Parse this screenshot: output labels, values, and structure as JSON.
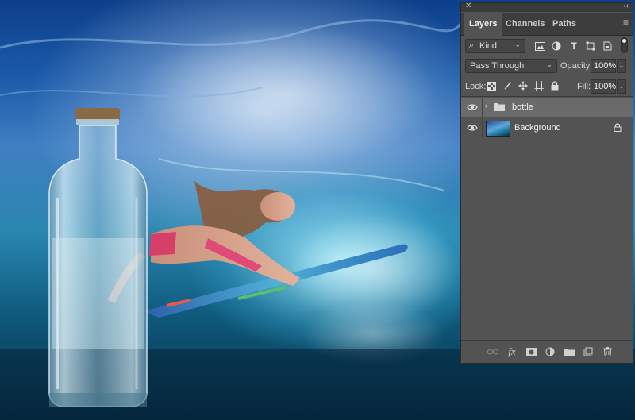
{
  "panel": {
    "tabs": [
      {
        "label": "Layers"
      },
      {
        "label": "Channels"
      },
      {
        "label": "Paths"
      }
    ],
    "filter": {
      "kind_label": "Kind"
    },
    "blend_mode": "Pass Through",
    "opacity_label": "Opacity:",
    "opacity_value": "100%",
    "lock_label": "Lock:",
    "fill_label": "Fill:",
    "fill_value": "100%",
    "layers": [
      {
        "name": "bottle",
        "type": "group",
        "selected": true,
        "visible": true
      },
      {
        "name": "Background",
        "type": "image",
        "selected": false,
        "visible": true,
        "locked": true
      }
    ]
  },
  "colors": {
    "panel_bg": "#535353",
    "tab_bar_bg": "#3d3d3d",
    "selected_row": "#6a6a6a",
    "text": "#e0e0e0"
  }
}
